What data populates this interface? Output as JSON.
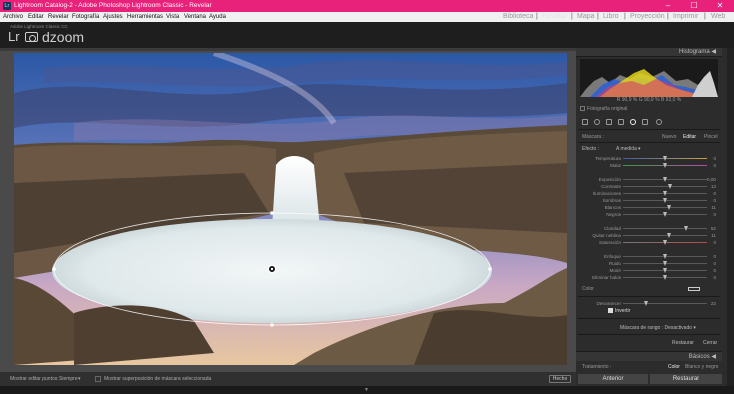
{
  "window": {
    "title": "Lightroom Catalog-2 - Adobe Photoshop Lightroom Classic - Revelar",
    "controls": [
      "–",
      "☐",
      "✕"
    ]
  },
  "menu": [
    "Archivo",
    "Editar",
    "Revelar",
    "Fotografía",
    "Ajustes",
    "Herramientas",
    "Vista",
    "Ventana",
    "Ayuda"
  ],
  "identity": {
    "catalog_label": "Adobe Lightroom Classic CC",
    "logo_lr": "Lr",
    "logo_text": "dzoom"
  },
  "modules": {
    "items": [
      "Biblioteca",
      "Revelar",
      "Mapa",
      "Libro",
      "Proyección",
      "Imprimir",
      "Web"
    ],
    "active": "Revelar",
    "separator": "|"
  },
  "toolbar": {
    "show_pins_label": "Mostrar editar puntos:",
    "show_pins_value": "Siempre",
    "overlay_label": "Mostrar superposición de máscara seleccionada",
    "done_button": "Hecho"
  },
  "histogram": {
    "header": "Histograma",
    "readout": "R  90,9  %    G  90,9  %    B  92,0  %",
    "original_photo": "Fotografía original"
  },
  "mask_panel": {
    "tabs": {
      "mask": "Máscara :",
      "new": "Nuevo",
      "edit": "Editar",
      "brush": "Pincel"
    },
    "effect_label": "Efecto :",
    "effect_value": "A medida",
    "adjustments": [
      {
        "label": "Temperatura",
        "value": 0,
        "pos": 0.5
      },
      {
        "label": "Matiz",
        "value": 0,
        "pos": 0.5
      },
      {
        "label": "Exposición",
        "value": "0,00",
        "pos": 0.5
      },
      {
        "label": "Contraste",
        "value": 13,
        "pos": 0.56
      },
      {
        "label": "Iluminaciones",
        "value": 0,
        "pos": 0.5
      },
      {
        "label": "Sombras",
        "value": 0,
        "pos": 0.5
      },
      {
        "label": "Blancos",
        "value": 11,
        "pos": 0.55
      },
      {
        "label": "Negros",
        "value": 0,
        "pos": 0.5
      },
      {
        "label": "Claridad",
        "value": 52,
        "pos": 0.76
      },
      {
        "label": "Quitar neblina",
        "value": 11,
        "pos": 0.55
      },
      {
        "label": "Saturación",
        "value": 0,
        "pos": 0.5
      },
      {
        "label": "Enfoque",
        "value": 0,
        "pos": 0.5
      },
      {
        "label": "Ruido",
        "value": 0,
        "pos": 0.5
      },
      {
        "label": "Moiré",
        "value": 0,
        "pos": 0.5
      },
      {
        "label": "Eliminar halos",
        "value": 0,
        "pos": 0.5
      }
    ],
    "color_label": "Color",
    "feather_label": "Desvanecer",
    "feather_value": 22,
    "feather_pos": 0.28,
    "invert_label": "Invertir",
    "range_mask_label": "Máscara de rango :",
    "range_mask_value": "Desactivado",
    "reset_button": "Restaurar",
    "close_button": "Cerrar"
  },
  "basics_panel": {
    "header": "Básicos",
    "treatment_label": "Tratamiento :",
    "color_option": "Color",
    "bw_option": "Blanco y negro"
  },
  "footer_buttons": {
    "previous": "Anterior",
    "reset": "Restaurar"
  },
  "colors": {
    "titlebar": "#e8217a",
    "panel": "#2c2c2c",
    "active_module": "#e6e6e6"
  }
}
